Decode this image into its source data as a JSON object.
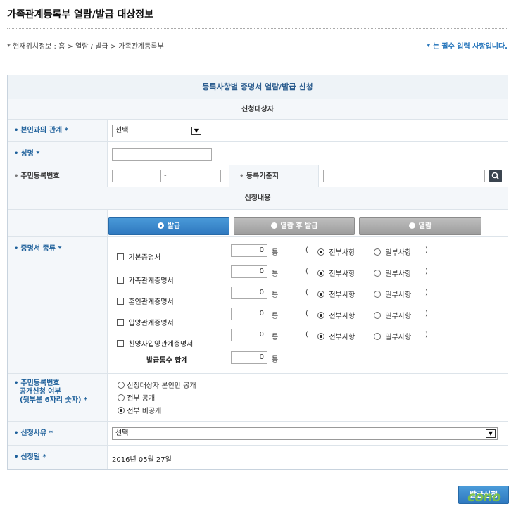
{
  "page": {
    "title": "가족관계등록부 열람/발급 대상정보",
    "breadcrumb": "* 현재위치정보 : 홈 > 열람 / 발급 > 가족관계등록부",
    "required_note": "* 는 필수 입력 사항입니다."
  },
  "form": {
    "header": "등록사항별 증명서 열람/발급 신청",
    "target_section": "신청대상자",
    "relation": {
      "label": "본인과의 관계 *",
      "value": "선택"
    },
    "name": {
      "label": "성명 *",
      "value": ""
    },
    "rrn": {
      "label": "주민등록번호",
      "front": "",
      "dash": "-",
      "back": ""
    },
    "domicile": {
      "label": "등록기준지",
      "value": ""
    },
    "content_section": "신청내용",
    "tabs": [
      {
        "label": "발급",
        "active": true
      },
      {
        "label": "열람 후 발급",
        "active": false
      },
      {
        "label": "열람",
        "active": false
      }
    ],
    "cert_type_label": "증명서 종류 *",
    "certificates": [
      {
        "name": "기본증명서",
        "count": "0",
        "unit": "통",
        "paren_open": "(",
        "all": "전부사항",
        "part": "일부사항",
        "paren_close": ")"
      },
      {
        "name": "가족관계증명서",
        "count": "0",
        "unit": "통",
        "paren_open": "(",
        "all": "전부사항",
        "part": "일부사항",
        "paren_close": ")"
      },
      {
        "name": "혼인관계증명서",
        "count": "0",
        "unit": "통",
        "paren_open": "(",
        "all": "전부사항",
        "part": "일부사항",
        "paren_close": ")"
      },
      {
        "name": "입양관계증명서",
        "count": "0",
        "unit": "통",
        "paren_open": "(",
        "all": "전부사항",
        "part": "일부사항",
        "paren_close": ")"
      },
      {
        "name": "친양자입양관계증명서",
        "count": "0",
        "unit": "통",
        "paren_open": "(",
        "all": "전부사항",
        "part": "일부사항",
        "paren_close": ")"
      }
    ],
    "total": {
      "label": "발급통수 합계",
      "count": "0",
      "unit": "통"
    },
    "disclosure": {
      "label_line1": "주민등록번호",
      "label_line2": "공개신청 여부",
      "label_line3": "(뒷부분 6자리 숫자) *",
      "options": [
        "신청대상자 본인만 공개",
        "전부 공개",
        "전부 비공개"
      ],
      "selected": 2
    },
    "reason": {
      "label": "신청사유 *",
      "value": "선택"
    },
    "date": {
      "label": "신청일 *",
      "value": "2016년 05월 27일"
    }
  },
  "submit_label": "발급신청",
  "logo_text": "cono",
  "colors": {
    "accent": "#2f78bf",
    "label_blue": "#1c5f9a",
    "header_bg": "#eef3f7"
  }
}
